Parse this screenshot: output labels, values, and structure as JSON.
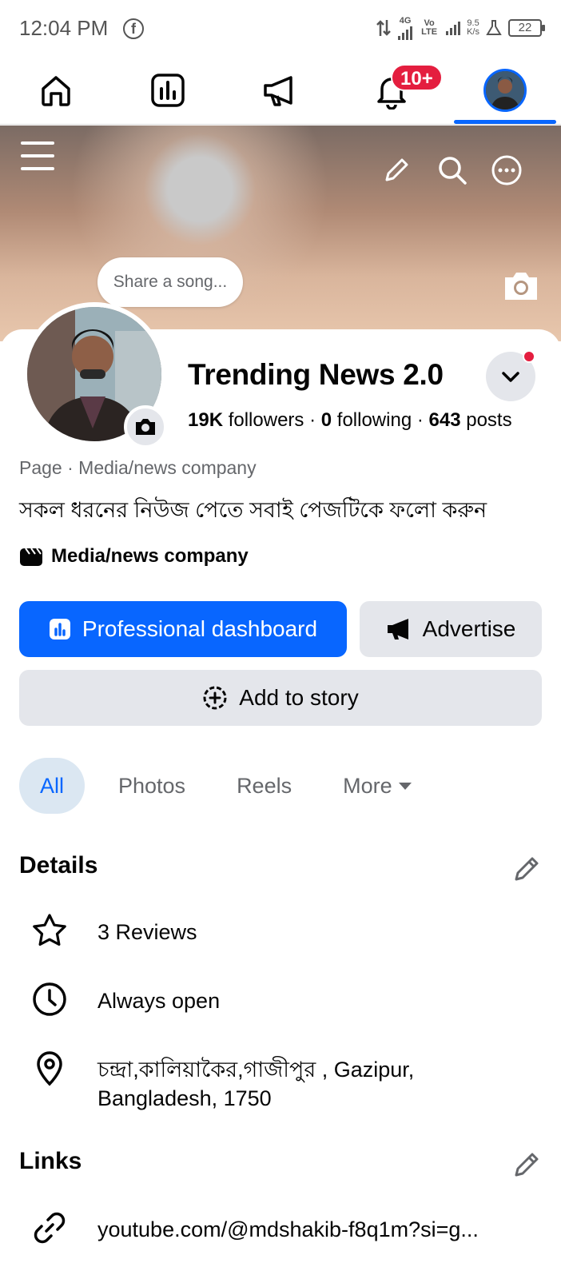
{
  "status_bar": {
    "time": "12:04 PM",
    "network_type": "4G",
    "volte": "Vo LTE",
    "speed_value": "9.5",
    "speed_unit": "K/s",
    "battery": "22"
  },
  "nav": {
    "notification_badge": "10+",
    "active_tab": "profile"
  },
  "cover": {
    "song_prompt": "Share a song..."
  },
  "profile": {
    "page_name": "Trending News 2.0",
    "followers_count": "19K",
    "followers_label": "followers",
    "following_count": "0",
    "following_label": "following",
    "posts_count": "643",
    "posts_label": "posts",
    "category_line": "Page · Media/news company",
    "bio": "সকল ধরনের নিউজ পেতে সবাই পেজটিকে ফলো করুন",
    "category": "Media/news company"
  },
  "actions": {
    "professional_dashboard": "Professional dashboard",
    "advertise": "Advertise",
    "add_to_story": "Add to story"
  },
  "tabs": [
    "All",
    "Photos",
    "Reels",
    "More"
  ],
  "details": {
    "title": "Details",
    "reviews": "3 Reviews",
    "hours": "Always open",
    "address_line1": "চন্দ্রা,কালিয়াকৈর,গাজীপুর , Gazipur,",
    "address_line2": "Bangladesh, 1750"
  },
  "links": {
    "title": "Links",
    "url": "youtube.com/@mdshakib-f8q1m?si=g..."
  },
  "colors": {
    "accent": "#0866ff",
    "badge": "#e41e3f",
    "secondary_button": "#e4e6eb",
    "active_tab_bg": "#dbe7f2"
  }
}
